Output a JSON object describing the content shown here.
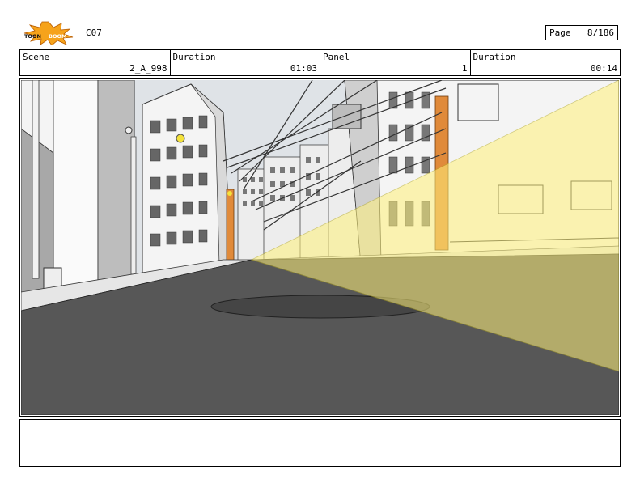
{
  "header": {
    "sheet_code": "C07",
    "page_label": "Page",
    "page_value": "8/186"
  },
  "info": {
    "scene_label": "Scene",
    "scene_value": "2_A_998",
    "duration_label": "Duration",
    "duration_value": "01:03",
    "panel_label": "Panel",
    "panel_value": "1",
    "panel_duration_label": "Duration",
    "panel_duration_value": "00:14"
  },
  "notes": {
    "text": ""
  },
  "colors": {
    "road": "#575757",
    "sky": "#dfe3e7",
    "building": "#f2f2f2",
    "light_cone": "#fff17a",
    "pole": "#e08a3a",
    "logo_burst": "#f6a31b"
  }
}
